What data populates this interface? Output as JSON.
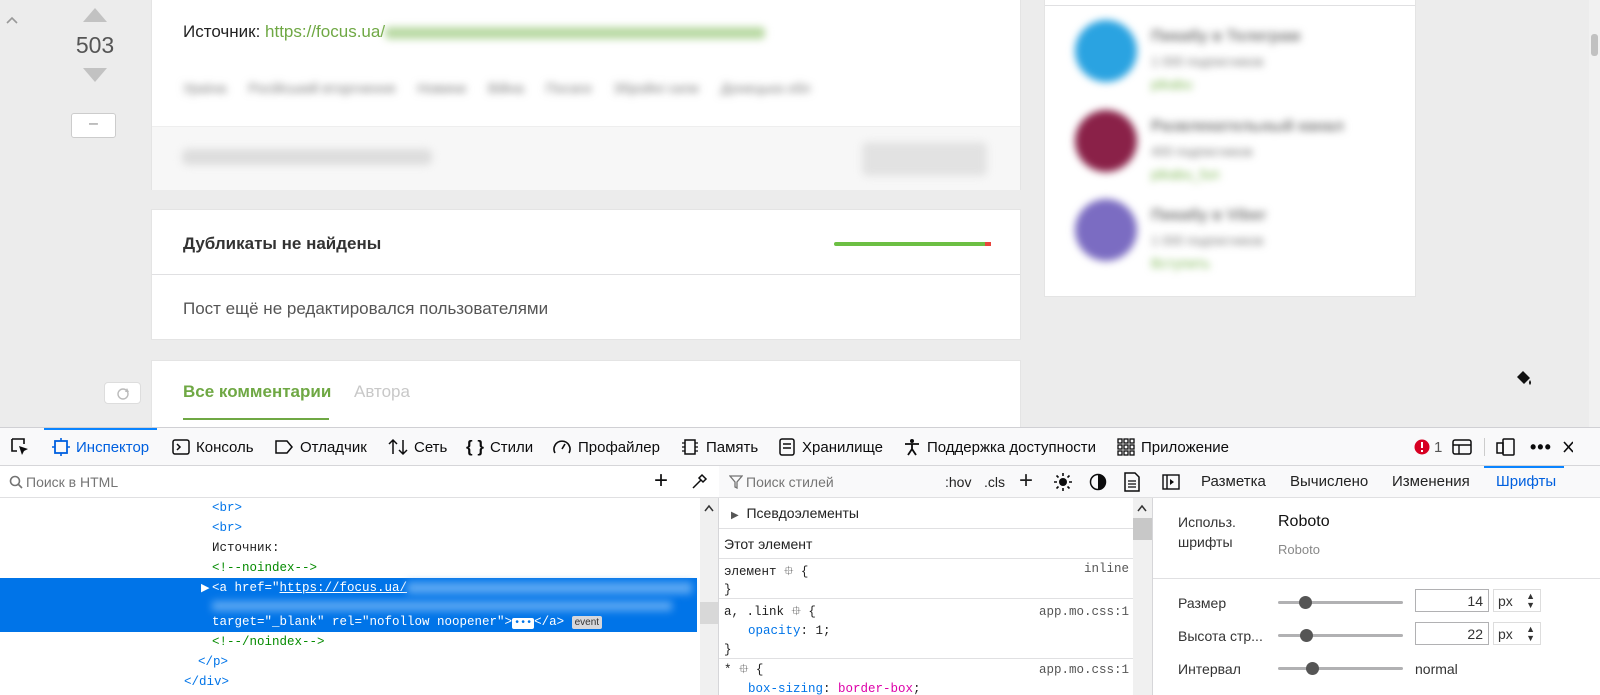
{
  "post": {
    "score": "503",
    "source_label": "Источник:",
    "source_link": "https://focus.ua/",
    "tags": [
      "Ураїна",
      "Російський вторгнення",
      "Новини",
      "Війна",
      "Посаги",
      "Збройні сили",
      "Донецька обл"
    ]
  },
  "duplicates": {
    "title": "Дубликаты не найдены"
  },
  "edited": {
    "text": "Пост ещё не редактировался пользователями"
  },
  "comments": {
    "tab_all": "Все комментарии",
    "tab_author": "Автора"
  },
  "sidebar": {
    "items": [
      {
        "title": "Пикабу в Телеграм",
        "sub": "1 000 подписчиков",
        "link": "pikabu",
        "color": "#2aa3e1"
      },
      {
        "title": "Развлекательный канал",
        "sub": "400 подписчиков",
        "link": "pikabu_fun",
        "color": "#8a2148"
      },
      {
        "title": "Пикабу в Viber",
        "sub": "1 000 подписчиков",
        "link": "Вступить",
        "color": "#7b6cc2"
      }
    ]
  },
  "devtools": {
    "tabs": [
      "Инспектор",
      "Консоль",
      "Отладчик",
      "Сеть",
      "Стили",
      "Профайлер",
      "Память",
      "Хранилище",
      "Поддержка доступности",
      "Приложение"
    ],
    "error_count": "1",
    "html_search_placeholder": "Поиск в HTML",
    "styles_search_placeholder": "Поиск стилей",
    "hov": ":hov",
    "cls": ".cls",
    "html_lines": {
      "br1": "<br>",
      "br2": "<br>",
      "text": "Источник:",
      "noindex_open": "<!--noindex-->",
      "a_start": "<a href=\"",
      "a_url": "https://focus.ua/",
      "a_attrs": "target=\"_blank\" rel=\"nofollow noopener\">",
      "a_end": "</a>",
      "event": "event",
      "noindex_close": "<!--/noindex-->",
      "p_close": "</p>",
      "div_close": "</div>"
    },
    "rules": {
      "pseudo": "Псевдоэлементы",
      "this_element": "Этот элемент",
      "r1_selector": "элемент",
      "r1_source": "inline",
      "r2_selector": "a, .link",
      "r2_source": "app.mo.css:1",
      "r2_prop": "opacity",
      "r2_val": "1",
      "r3_selector": "*",
      "r3_source": "app.mo.css:1",
      "r3_prop": "box-sizing",
      "r3_val": "border-box"
    },
    "right_tabs": [
      "Разметка",
      "Вычислено",
      "Изменения",
      "Шрифты"
    ],
    "fonts": {
      "used_label_1": "Использ.",
      "used_label_2": "шрифты",
      "font_name": "Roboto",
      "font_sub": "Roboto",
      "size_label": "Размер",
      "size_value": "14",
      "size_unit": "px",
      "lh_label": "Высота стр...",
      "lh_value": "22",
      "lh_unit": "px",
      "spacing_label": "Интервал",
      "spacing_value": "normal"
    }
  }
}
